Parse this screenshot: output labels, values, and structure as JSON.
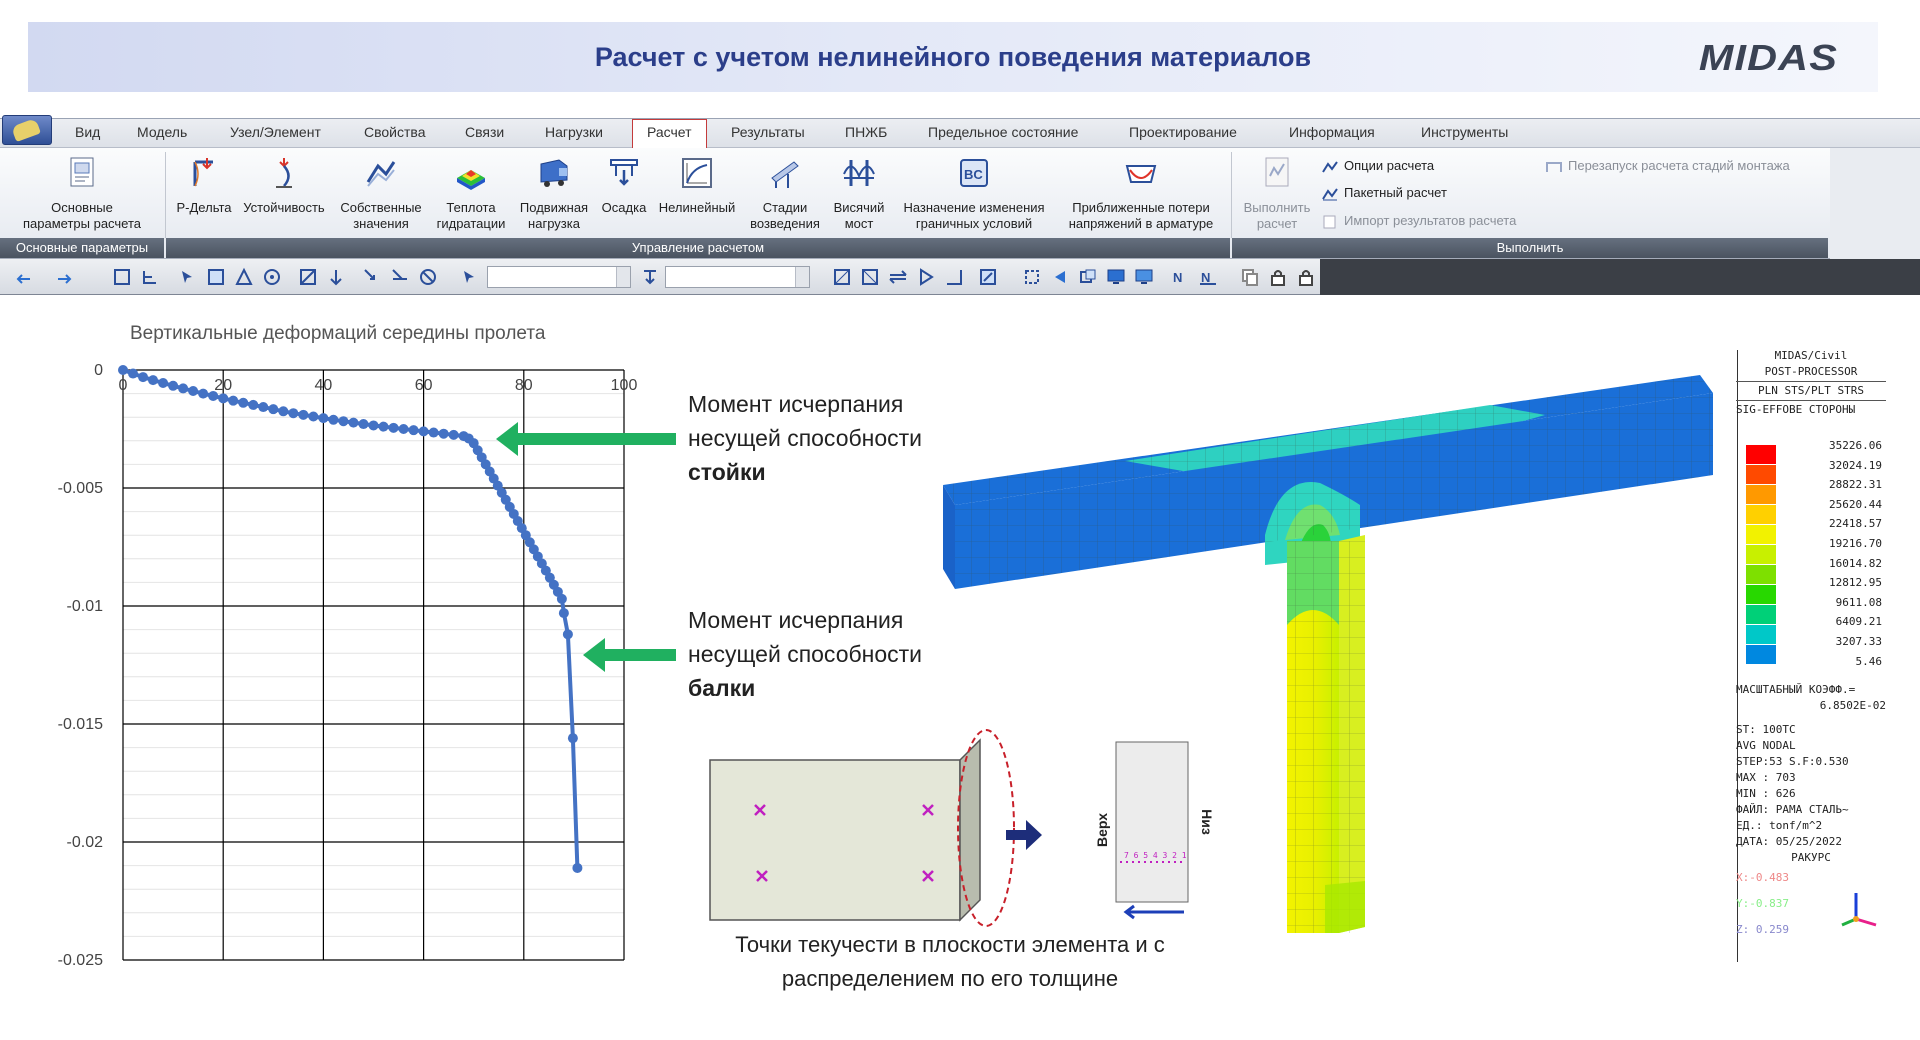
{
  "slide": {
    "title": "Расчет с учетом нелинейного поведения материалов",
    "logo": "MIDAS"
  },
  "ribbon": {
    "tabs": [
      "Вид",
      "Модель",
      "Узел/Элемент",
      "Свойства",
      "Связи",
      "Нагрузки",
      "Расчет",
      "Результаты",
      "ПНЖБ",
      "Предельное состояние",
      "Проектирование",
      "Информация",
      "Инструменты"
    ],
    "active_tab": "Расчет",
    "basic": {
      "line1": "Основные",
      "line2": "параметры расчета",
      "group": "Основные параметры"
    },
    "control_group": "Управление расчетом",
    "buttons": [
      {
        "l1": "P-Дельта",
        "l2": ""
      },
      {
        "l1": "Устойчивость",
        "l2": ""
      },
      {
        "l1": "Собственные",
        "l2": "значения"
      },
      {
        "l1": "Теплота",
        "l2": "гидратации"
      },
      {
        "l1": "Подвижная",
        "l2": "нагрузка"
      },
      {
        "l1": "Осадка",
        "l2": ""
      },
      {
        "l1": "Нелинейный",
        "l2": ""
      },
      {
        "l1": "Стадии",
        "l2": "возведения"
      },
      {
        "l1": "Висячий",
        "l2": "мост"
      },
      {
        "l1": "Назначение изменения",
        "l2": "граничных условий"
      },
      {
        "l1": "Приближенные потери",
        "l2": "напряжений в арматуре"
      }
    ],
    "run": {
      "l1": "Выполнить",
      "l2": "расчет",
      "group": "Выполнить"
    },
    "small": {
      "options": "Опции расчета",
      "batch": "Пакетный расчет",
      "import": "Импорт результатов расчета",
      "restart": "Перезапуск расчета стадий монтажа"
    }
  },
  "chart_data": {
    "type": "line",
    "title": "Вертикальные деформаций середины пролета",
    "x_ticks": [
      "0",
      "20",
      "40",
      "60",
      "80",
      "100"
    ],
    "y_ticks": [
      "0",
      "-0.005",
      "-0.01",
      "-0.015",
      "-0.02",
      "-0.025"
    ],
    "xlim": [
      0,
      100
    ],
    "ylim": [
      -0.025,
      0
    ],
    "grid": true,
    "series": [
      {
        "color": "#4472c4",
        "x": [
          0,
          2,
          4,
          6,
          8,
          10,
          12,
          14,
          16,
          18,
          20,
          22,
          24,
          26,
          28,
          30,
          32,
          34,
          36,
          38,
          40,
          42,
          44,
          46,
          48,
          50,
          52,
          54,
          56,
          58,
          60,
          62,
          64,
          66,
          68,
          69,
          70,
          70.8,
          71.6,
          72.4,
          73.2,
          74,
          74.8,
          75.6,
          76.4,
          77.2,
          78,
          78.8,
          79.6,
          80.4,
          81.2,
          82,
          82.8,
          83.6,
          84.4,
          85.2,
          86,
          86.8,
          87.6,
          88,
          88.8,
          89.8,
          90.7
        ],
        "y": [
          0,
          -0.00015,
          -0.0003,
          -0.00043,
          -0.00055,
          -0.00067,
          -0.00078,
          -0.00089,
          -0.001,
          -0.0011,
          -0.0012,
          -0.0013,
          -0.00139,
          -0.00148,
          -0.00157,
          -0.00166,
          -0.00175,
          -0.00183,
          -0.0019,
          -0.00197,
          -0.00204,
          -0.00211,
          -0.00217,
          -0.00223,
          -0.00229,
          -0.00235,
          -0.0024,
          -0.00245,
          -0.0025,
          -0.00255,
          -0.0026,
          -0.00265,
          -0.0027,
          -0.00275,
          -0.0028,
          -0.0029,
          -0.0031,
          -0.0034,
          -0.0037,
          -0.004,
          -0.0043,
          -0.0046,
          -0.0049,
          -0.0052,
          -0.0055,
          -0.0058,
          -0.0061,
          -0.0064,
          -0.0067,
          -0.007,
          -0.0073,
          -0.0076,
          -0.0079,
          -0.0082,
          -0.0085,
          -0.0088,
          -0.0091,
          -0.0094,
          -0.0097,
          -0.0103,
          -0.0112,
          -0.0156,
          -0.0211
        ]
      }
    ]
  },
  "annotations": {
    "column": {
      "l1": "Момент исчерпания",
      "l2": "несущей способности",
      "bold": "стойки"
    },
    "beam": {
      "l1": "Момент исчерпания",
      "l2": "несущей способности",
      "bold": "балки"
    }
  },
  "diagram": {
    "caption_l1": "Точки текучести в плоскости элемента и с",
    "caption_l2": "распределением по его толщине",
    "top_label": "Верх",
    "bottom_label": "Низ",
    "point_digits": "7 6 5 4 3 2 1"
  },
  "legend": {
    "header": [
      "MIDAS/Civil",
      "POST-PROCESSOR",
      "PLN STS/PLT STRS",
      "SIG-EFFOBE СТОРОНЫ"
    ],
    "values": [
      "35226.06",
      "32024.19",
      "28822.31",
      "25620.44",
      "22418.57",
      "19216.70",
      "16014.82",
      "12812.95",
      "9611.08",
      "6409.21",
      "3207.33",
      "5.46"
    ],
    "colors": [
      "#ff0000",
      "#ff4a00",
      "#ff9900",
      "#ffd000",
      "#f2f200",
      "#c8f000",
      "#7ee000",
      "#28d800",
      "#00d078",
      "#00c8c8",
      "#0088e0",
      "#1050d8"
    ],
    "scale_label": "МАСШТАБНЫЙ КОЭФФ.=",
    "scale_value": "6.8502E-02",
    "info": [
      "ST: 100TC",
      "AVG NODAL",
      "STEP:53 S.F:0.530",
      "MAX : 703",
      "MIN : 626",
      "ФАЙЛ: РАМА СТАЛЬ~",
      "ЕД.:  tonf/m^2",
      "ДАТА: 05/25/2022"
    ],
    "view_label": "РАКУРС",
    "view_x": "X:-0.483",
    "view_y": "Y:-0.837",
    "view_z": "Z: 0.259"
  }
}
